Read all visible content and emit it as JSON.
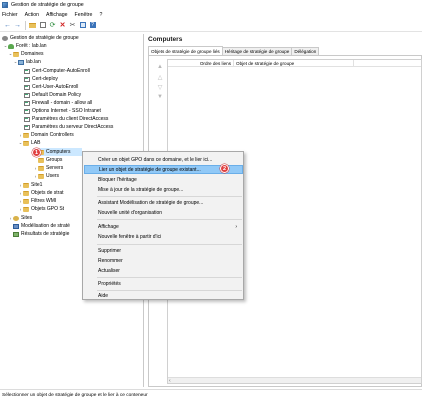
{
  "window": {
    "title": "Gestion de stratégie de groupe"
  },
  "menu": [
    "Fichier",
    "Action",
    "Affichage",
    "Fenêtre",
    "?"
  ],
  "toolbar": [
    "back-icon",
    "forward-icon",
    "folder-icon",
    "properties-icon",
    "refresh-icon",
    "delete-icon",
    "cut-icon",
    "export-icon",
    "help-icon"
  ],
  "tree": {
    "root": "Gestion de stratégie de groupe",
    "forest": "Forêt : lab.lan",
    "domains": "Domaines",
    "domain": "lab.lan",
    "gpos": [
      "Cert-Computer-AutoEnroll",
      "Cert-deploy",
      "Cert-User-AutoEnroll",
      "Default Domain Policy",
      "Firewall - domain - allow all",
      "Options Internet - SSO Intranet",
      "Paramètres du client DirectAccess",
      "Paramètres du serveur DirectAccess"
    ],
    "domain_controllers": "Domain Controllers",
    "lab": "LAB",
    "lab_children": [
      "Computers",
      "Groups",
      "Servers",
      "Users"
    ],
    "site1": "Site1",
    "objets_strat": "Objets de strat",
    "filtres_wmi": "Filtres WMI",
    "objets_gpo": "Objets GPO St",
    "sites": "Sites",
    "modelisation": "Modélisation de straté",
    "resultats": "Résultats de stratégie"
  },
  "badges": {
    "one": "1",
    "two": "2"
  },
  "right": {
    "title": "Computers",
    "tabs": [
      "Objets de stratégie de groupe liés",
      "Héritage de stratégie de groupe",
      "Délégation"
    ],
    "columns": [
      "Ordre des liens",
      "Objet de stratégie de groupe"
    ]
  },
  "context_menu": {
    "items": [
      "Créer un objet GPO dans ce domaine, et le lier ici...",
      "Lier un objet de stratégie de groupe existant...",
      "Bloquer l'héritage",
      "Mise à jour de la stratégie de groupe...",
      "Assistant Modélisation de stratégie de groupe...",
      "Nouvelle unité d'organisation",
      "Affichage",
      "Nouvelle fenêtre à partir d'ici",
      "Supprimer",
      "Renommer",
      "Actualiser",
      "Propriétés",
      "Aide"
    ],
    "highlighted_index": 1
  },
  "status": "Sélectionner un objet de stratégie de groupe et le lier à ce conteneur"
}
